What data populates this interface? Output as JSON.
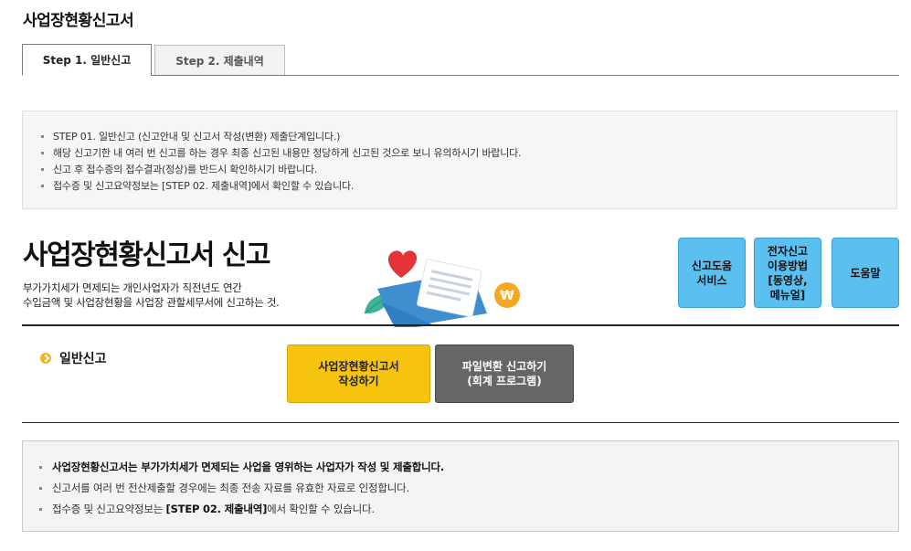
{
  "page": {
    "title": "사업장현황신고서"
  },
  "tabs": [
    {
      "label": "Step 1. 일반신고",
      "active": true
    },
    {
      "label": "Step 2. 제출내역",
      "active": false
    }
  ],
  "info": {
    "items": [
      "STEP 01. 일반신고 (신고안내 및 신고서 작성(변환) 제출단계입니다.)",
      "해당 신고기한 내 여러 번 신고를 하는 경우 최종 신고된 내용만 정당하게 신고된 것으로 보니 유의하시기 바랍니다.",
      "신고 후 접수증의 접수결과(정상)를 반드시 확인하시기 바랍니다.",
      "접수증 및 신고요약정보는 [STEP 02. 제출내역]에서 확인할 수 있습니다."
    ]
  },
  "hero": {
    "title": "사업장현황신고서 신고",
    "desc_line1": "부가가치세가 면제되는 개인사업자가 직전년도 연간",
    "desc_line2": "수입금액 및 사업장현황을 사업장 관할세무서에 신고하는 것."
  },
  "help_buttons": {
    "service": "신고도움\n서비스",
    "howto": "전자신고\n이용방법\n[동영상,\n메뉴얼]",
    "help": "도움말"
  },
  "section": {
    "label": "일반신고",
    "write_button": "사업장현황신고서\n작성하기",
    "convert_button": "파일변환 신고하기\n(회계 프로그램)"
  },
  "notice": {
    "line1": "사업장현황신고서는 부가가치세가 면제되는 사업을 영위하는 사업자가 작성 및 제출합니다.",
    "line2": "신고서를 여러 번 전산제출할 경우에는 최종 전송 자료를 유효한 자료로 인정합니다.",
    "line3_pre": "접수증 및 신고요약정보는 ",
    "line3_bold": "[STEP 02. 제출내역]",
    "line3_post": "에서 확인할 수 있습니다."
  },
  "colors": {
    "help_button": "#5bc0f0",
    "write_button": "#f6c40f",
    "convert_button": "#666666",
    "info_bg": "#f4f6f8"
  }
}
